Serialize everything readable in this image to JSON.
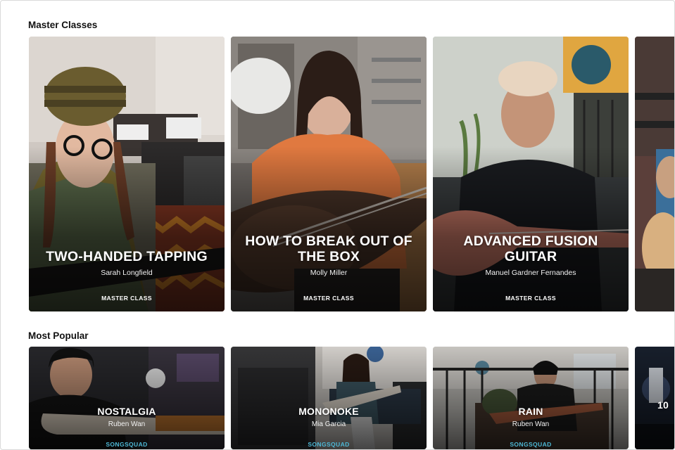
{
  "sections": {
    "master": {
      "title": "Master Classes",
      "cards": [
        {
          "title": "TWO-HANDED TAPPING",
          "author": "Sarah Longfield",
          "tag": "MASTER CLASS"
        },
        {
          "title": "HOW TO BREAK OUT OF THE BOX",
          "author": "Molly Miller",
          "tag": "MASTER CLASS"
        },
        {
          "title": "ADVANCED FUSION GUITAR",
          "author": "Manuel Gardner Fernandes",
          "tag": "MASTER CLASS"
        }
      ]
    },
    "popular": {
      "title": "Most Popular",
      "cards": [
        {
          "title": "NOSTALGIA",
          "author": "Ruben Wan",
          "tag": "SONGSQUAD"
        },
        {
          "title": "MONONOKE",
          "author": "Mia Garcia",
          "tag": "SONGSQUAD"
        },
        {
          "title": "RAIN",
          "author": "Ruben Wan",
          "tag": "SONGSQUAD"
        }
      ],
      "partial_title": "10"
    }
  },
  "colors": {
    "accent_tag": "#4db8d6",
    "background": "#ffffff"
  }
}
